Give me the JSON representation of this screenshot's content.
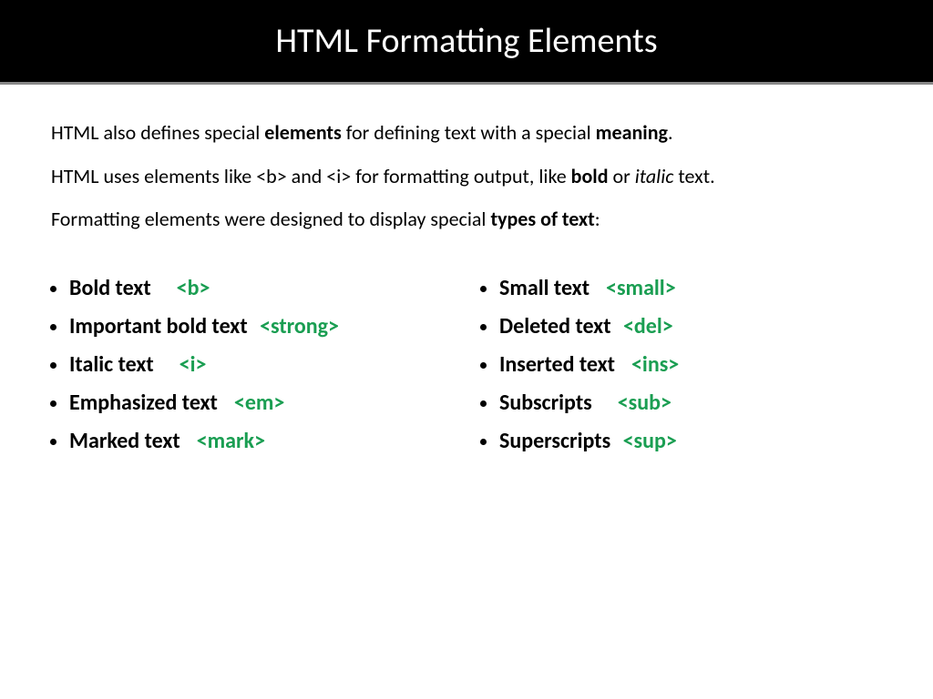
{
  "header": {
    "title": "HTML Formatting Elements"
  },
  "intro": {
    "p1_a": "HTML also defines special ",
    "p1_b": "elements",
    "p1_c": " for defining text with a special ",
    "p1_d": "meaning",
    "p1_e": ".",
    "p2_a": "HTML uses elements like <b> and <i> for formatting output, like ",
    "p2_b": "bold",
    "p2_c": " or ",
    "p2_d": "italic",
    "p2_e": " text.",
    "p3_a": "Formatting elements were designed to display special ",
    "p3_b": "types of text",
    "p3_c": ":"
  },
  "left": [
    {
      "label": "Bold text",
      "tag": "<b>"
    },
    {
      "label": "Important bold text",
      "tag": "<strong>"
    },
    {
      "label": "Italic text",
      "tag": "<i>"
    },
    {
      "label": "Emphasized text",
      "tag": "<em>"
    },
    {
      "label": "Marked text",
      "tag": "<mark>"
    }
  ],
  "right": [
    {
      "label": "Small text",
      "tag": "<small>"
    },
    {
      "label": "Deleted text",
      "tag": "<del>"
    },
    {
      "label": "Inserted text",
      "tag": "<ins>"
    },
    {
      "label": "Subscripts",
      "tag": "<sub>"
    },
    {
      "label": "Superscripts",
      "tag": "<sup>"
    }
  ]
}
